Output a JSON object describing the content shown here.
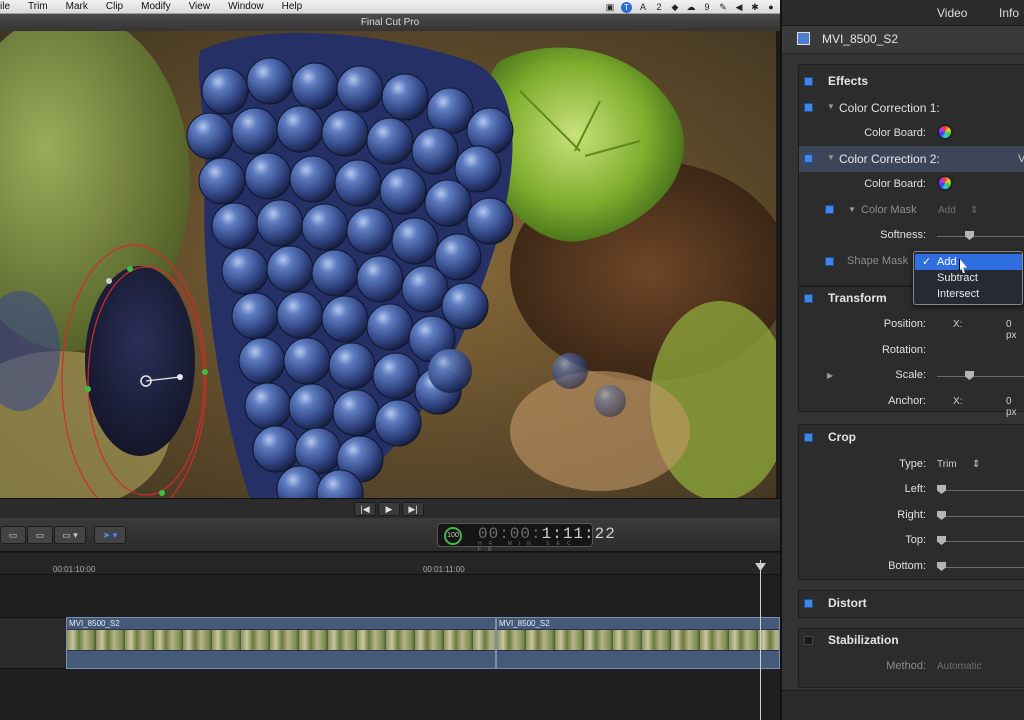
{
  "menubar": {
    "items": [
      "ile",
      "Trim",
      "Mark",
      "Clip",
      "Modify",
      "View",
      "Window",
      "Help"
    ],
    "status": {
      "wifi_count": "2",
      "cloud_count": "9"
    }
  },
  "window": {
    "title": "Final Cut Pro"
  },
  "viewer": {
    "transport": {
      "prev": "|◀",
      "play": "▶",
      "next": "▶|"
    }
  },
  "toolbar": {
    "timecode": {
      "dim_part": "00:00:",
      "bright_part": "1:11:22",
      "percent": "100",
      "units": "HR MIN SEC FR"
    }
  },
  "timeline": {
    "ruler": [
      "00:01:10:00",
      "00:01:11:00"
    ],
    "clips": [
      {
        "name": "MVI_8500_S2"
      },
      {
        "name": "MVI_8500_S2"
      }
    ]
  },
  "inspector": {
    "tabs": [
      "Video",
      "Info"
    ],
    "clip_name": "MVI_8500_S2",
    "effects_header": "Effects",
    "cc1": {
      "title": "Color Correction 1:",
      "color_board_label": "Color Board:"
    },
    "cc2": {
      "title": "Color Correction 2:",
      "suffix": "V",
      "color_board_label": "Color Board:"
    },
    "color_mask": {
      "label": "Color Mask",
      "value": "Add"
    },
    "softness": {
      "label": "Softness:"
    },
    "shape_mask": {
      "label": "Shape Mask"
    },
    "transform": {
      "header": "Transform",
      "position_label": "Position:",
      "position_axis": "X:",
      "position_value": "0 px",
      "rotation_label": "Rotation:",
      "scale_label": "Scale:",
      "anchor_label": "Anchor:",
      "anchor_axis": "X:",
      "anchor_value": "0 px"
    },
    "crop": {
      "header": "Crop",
      "type_label": "Type:",
      "type_value": "Trim",
      "left_label": "Left:",
      "right_label": "Right:",
      "top_label": "Top:",
      "bottom_label": "Bottom:"
    },
    "distort": {
      "header": "Distort"
    },
    "stabilization": {
      "header": "Stabilization",
      "method_label": "Method:",
      "method_value": "Automatic"
    }
  },
  "popup": {
    "options": [
      "Add",
      "Subtract",
      "Intersect"
    ],
    "selected": "Add"
  },
  "colors": {
    "accent": "#2f6fe0",
    "checkbox": "#3f86e6",
    "mask_outline": "#d42a2a",
    "mask_handle": "#3cc040"
  }
}
